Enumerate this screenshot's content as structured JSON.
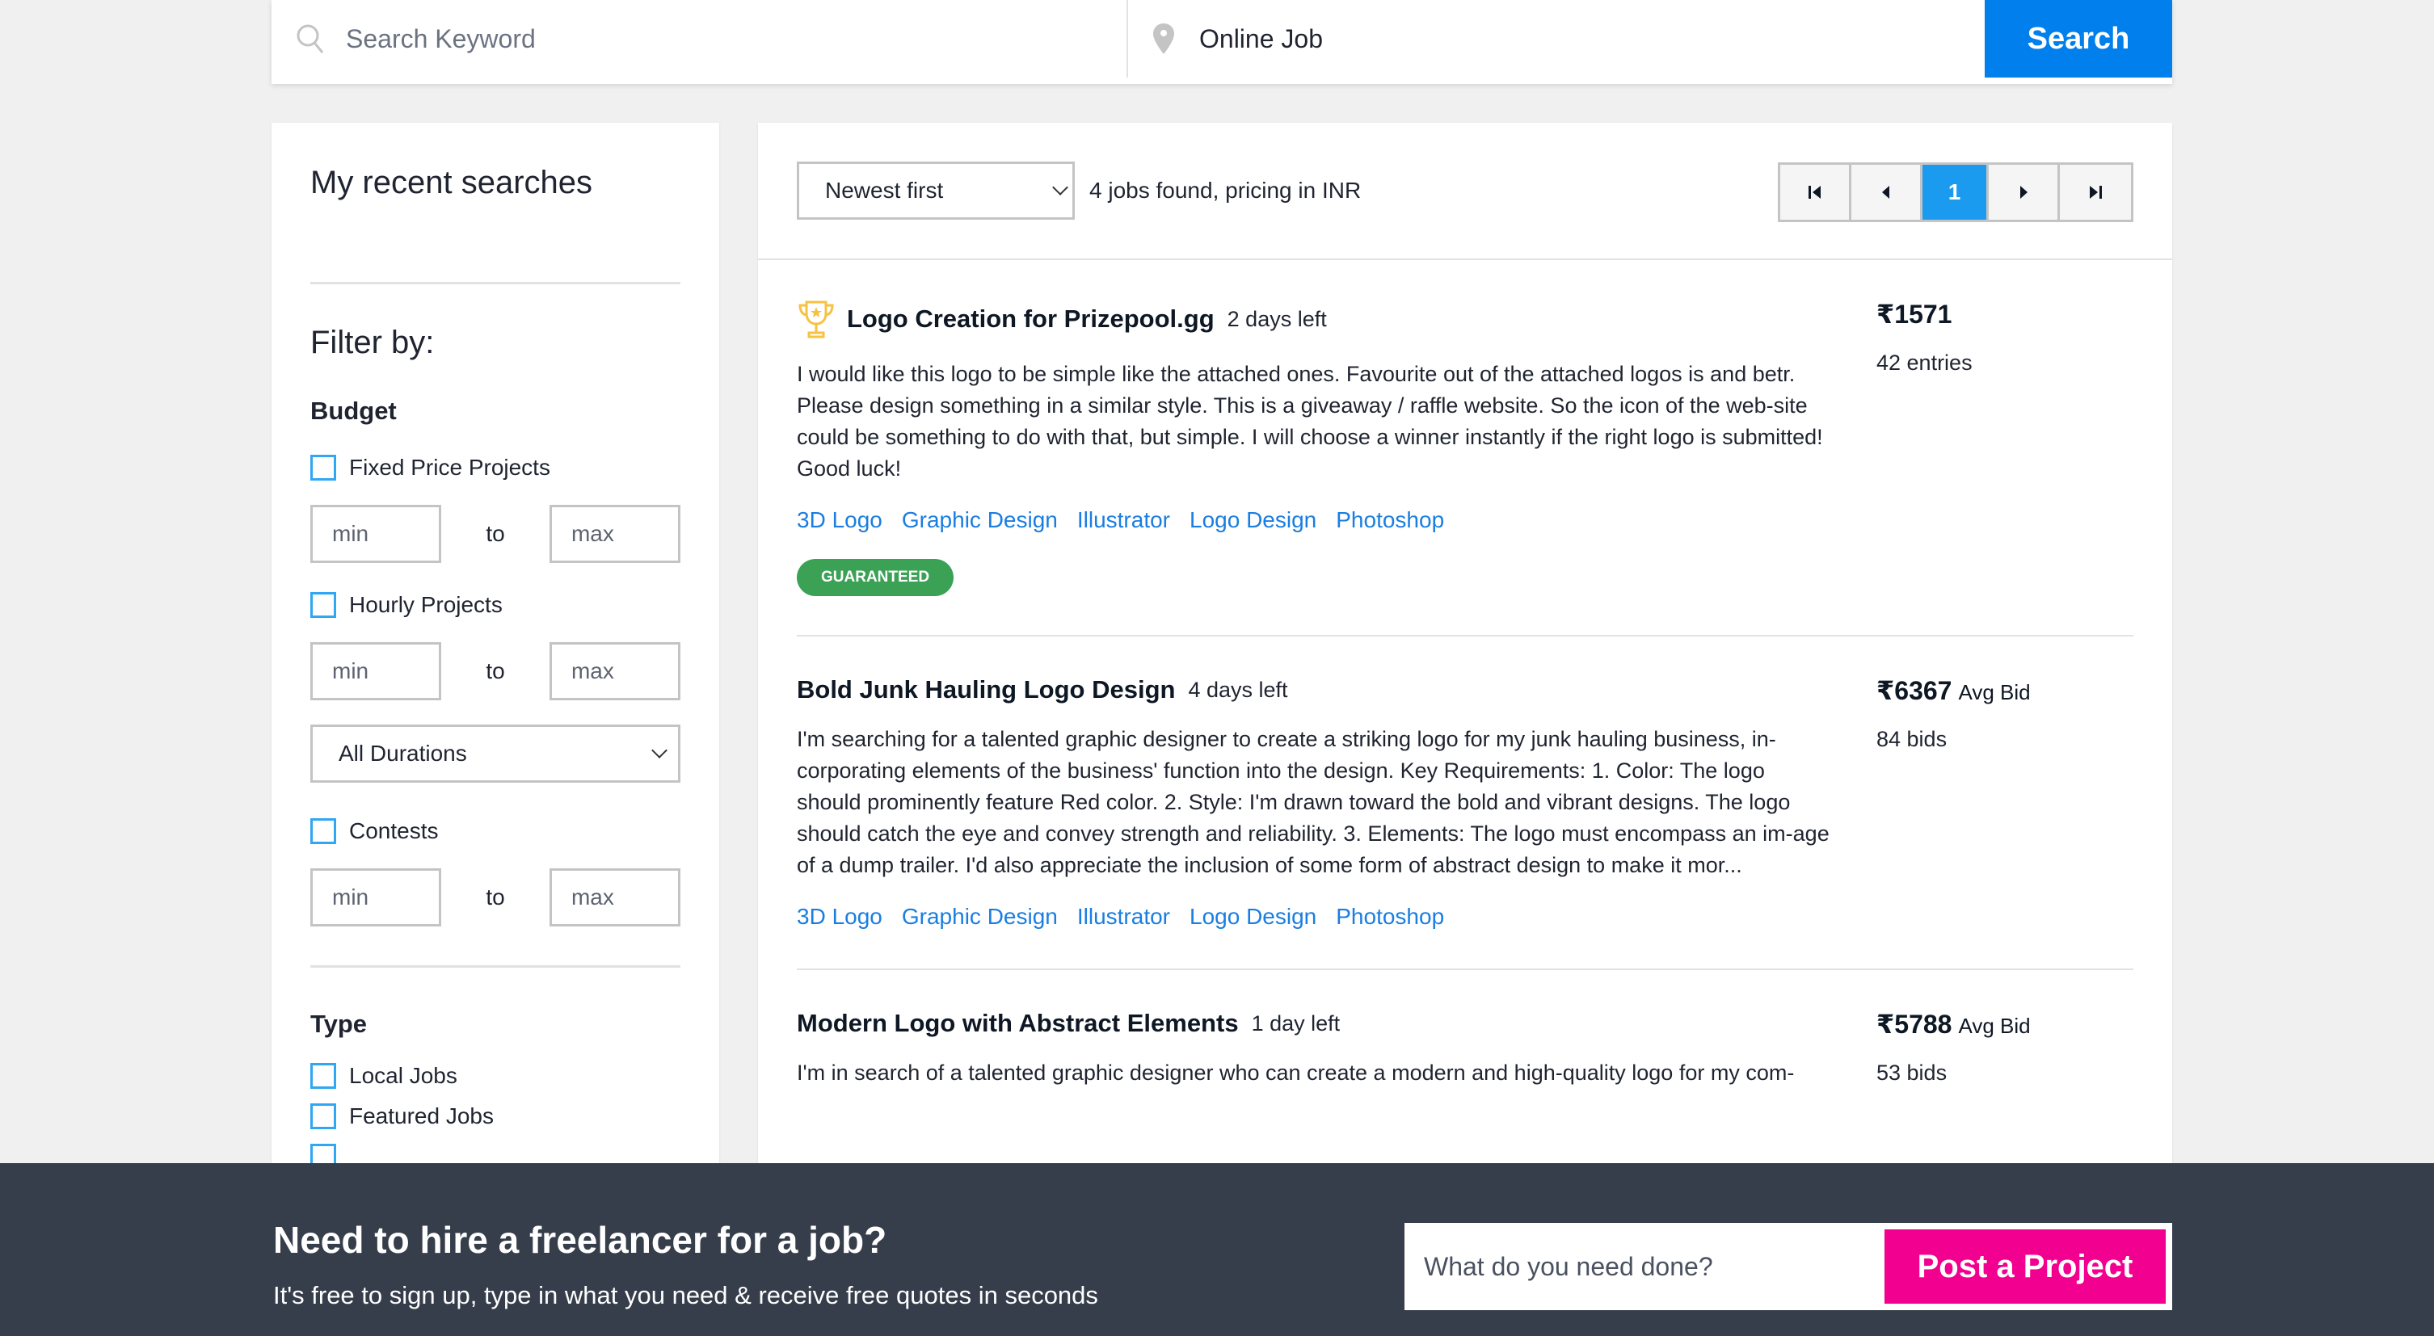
{
  "search": {
    "keyword_placeholder": "Search Keyword",
    "location_value": "Online Job",
    "button_label": "Search",
    "icons": [
      "search-icon",
      "location-pin-icon"
    ]
  },
  "sidebar": {
    "recent_title": "My recent searches",
    "filter_title": "Filter by:",
    "budget": {
      "title": "Budget",
      "fixed_label": "Fixed Price Projects",
      "hourly_label": "Hourly Projects",
      "contests_label": "Contests",
      "min_placeholder": "min",
      "max_placeholder": "max",
      "to_label": "to",
      "duration_selected": "All Durations"
    },
    "type": {
      "title": "Type",
      "items": [
        "Local Jobs",
        "Featured Jobs"
      ]
    }
  },
  "results": {
    "sort_selected": "Newest first",
    "count_text": "4 jobs found, pricing in INR",
    "pager": {
      "current_page": "1",
      "first_icon": "first-page-icon",
      "prev_icon": "prev-page-icon",
      "next_icon": "next-page-icon",
      "last_icon": "last-page-icon"
    },
    "jobs": [
      {
        "title": "Logo Creation for Prizepool.gg",
        "time_left": "2 days left",
        "icon": "trophy-icon",
        "description": "I would like this logo to be simple like the attached ones. Favourite out of the attached logos is and betr. Please design something in a similar style. This is a giveaway / raffle website. So the icon of the web-site could be something to do with that, but simple. I will choose a winner instantly if the right logo is submitted! Good luck!",
        "tags": [
          "3D Logo",
          "Graphic Design",
          "Illustrator",
          "Logo Design",
          "Photoshop"
        ],
        "badge": "GUARANTEED",
        "price": "₹1571",
        "price_suffix": "",
        "bids": "42 entries"
      },
      {
        "title": "Bold Junk Hauling Logo Design",
        "time_left": "4 days left",
        "description": "I'm searching for a talented graphic designer to create a striking logo for my junk hauling business, in-corporating elements of the business' function into the design. Key Requirements: 1. Color: The logo should prominently feature Red color. 2. Style: I'm drawn toward the bold and vibrant designs. The logo should catch the eye and convey strength and reliability. 3. Elements: The logo must encompass an im-age of a dump trailer. I'd also appreciate the inclusion of some form of abstract design to make it mor...",
        "tags": [
          "3D Logo",
          "Graphic Design",
          "Illustrator",
          "Logo Design",
          "Photoshop"
        ],
        "price": "₹6367",
        "price_suffix": "Avg Bid",
        "bids": "84 bids"
      },
      {
        "title": "Modern Logo with Abstract Elements",
        "time_left": "1 day left",
        "description": "I'm in search of a talented graphic designer who can create a modern and high-quality logo for my com-",
        "price": "₹5788",
        "price_suffix": "Avg Bid",
        "bids": "53 bids"
      }
    ]
  },
  "footer": {
    "title": "Need to hire a freelancer for a job?",
    "subtitle": "It's free to sign up, type in what you need & receive free quotes in seconds",
    "input_placeholder": "What do you need done?",
    "button_label": "Post a Project"
  },
  "colors": {
    "primary_blue": "#007fed",
    "active_page": "#1a9bf0",
    "tag_blue": "#1a7ee0",
    "guaranteed_green": "#3ba155",
    "post_pink": "#f2008f",
    "footer_bg": "#363e4b",
    "trophy_gold": "#f5c242"
  }
}
